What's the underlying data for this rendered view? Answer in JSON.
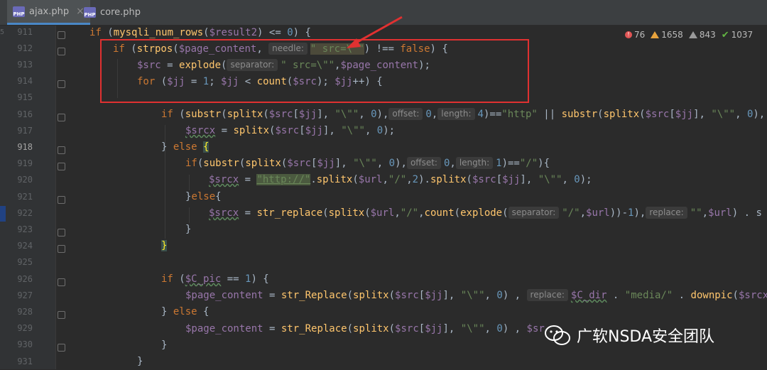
{
  "tabs": [
    {
      "label": "ajax.php",
      "icon": "php-file-icon",
      "active": true
    },
    {
      "label": "core.php",
      "icon": "php-file-icon",
      "active": false
    }
  ],
  "tab_close": "×",
  "php_badge": "PHP",
  "gutter_marker": "5.",
  "line_numbers": [
    "911",
    "912",
    "913",
    "914",
    "915",
    "916",
    "917",
    "918",
    "919",
    "920",
    "921",
    "922",
    "923",
    "924",
    "925",
    "926",
    "927",
    "928",
    "929",
    "930",
    "931"
  ],
  "inspections": {
    "errors": "76",
    "warnings": "1658",
    "weak_warnings": "843",
    "typos": "1037"
  },
  "hints": {
    "needle": "needle:",
    "separator": "separator:",
    "offset": "offset:",
    "length": "length:",
    "replace": "replace:"
  },
  "watermark": "广软NSDA安全团队",
  "colors": {
    "keyword": "#cc7832",
    "variable": "#9876aa",
    "string": "#6a8759",
    "number": "#6897bb",
    "annotation": "#e03131"
  }
}
